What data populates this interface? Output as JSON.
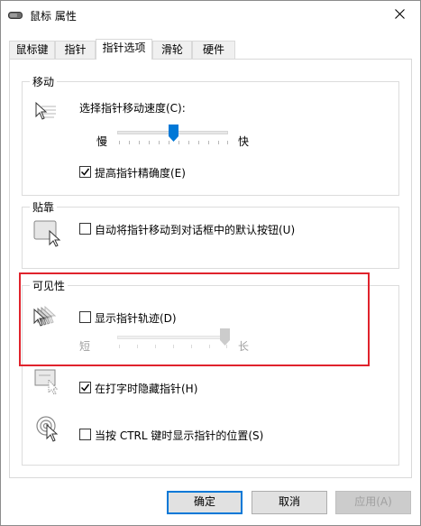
{
  "window": {
    "title": "鼠标 属性",
    "close_icon": "close-icon",
    "app_icon": "mouse-icon"
  },
  "tabs": [
    {
      "label": "鼠标键",
      "active": false
    },
    {
      "label": "指针",
      "active": false
    },
    {
      "label": "指针选项",
      "active": true
    },
    {
      "label": "滑轮",
      "active": false
    },
    {
      "label": "硬件",
      "active": false
    }
  ],
  "motion": {
    "label": "移动",
    "speed_label": "选择指针移动速度(C):",
    "slow": "慢",
    "fast": "快",
    "speed_value": 0.5,
    "enhance_label": "提高指针精确度(E)",
    "enhance_checked": true
  },
  "snap": {
    "label": "贴靠",
    "snap_label": "自动将指针移动到对话框中的默认按钮(U)",
    "snap_checked": false
  },
  "visibility": {
    "label": "可见性",
    "trails_label": "显示指针轨迹(D)",
    "trails_checked": false,
    "short": "短",
    "long": "长",
    "trails_value": 1.0,
    "hide_label": "在打字时隐藏指针(H)",
    "hide_checked": true,
    "ctrl_label": "当按 CTRL 键时显示指针的位置(S)",
    "ctrl_checked": false
  },
  "buttons": {
    "ok": "确定",
    "cancel": "取消",
    "apply": "应用(A)"
  },
  "colors": {
    "highlight_border": "#e0232c",
    "accent": "#0078d7"
  }
}
